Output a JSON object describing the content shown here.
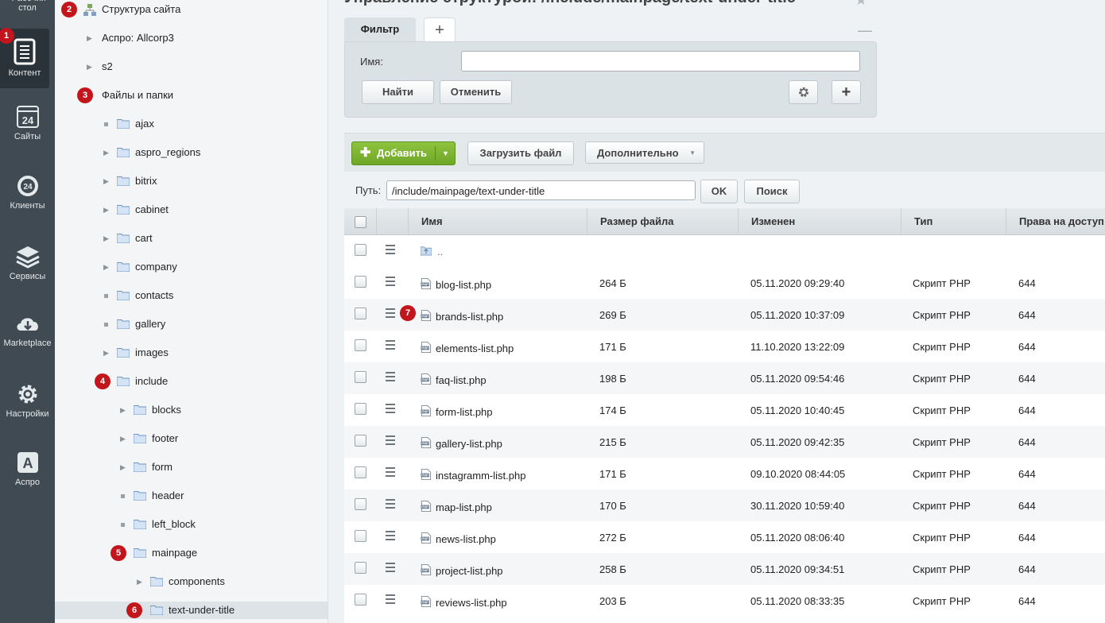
{
  "sidebar": {
    "items": [
      {
        "label": "Рабочий стол",
        "icon": "desktop-icon"
      },
      {
        "label": "Контент",
        "icon": "content-icon",
        "badge": "1"
      },
      {
        "label": "Сайты",
        "icon": "sites-icon"
      },
      {
        "label": "Клиенты",
        "icon": "clients-icon"
      },
      {
        "label": "Сервисы",
        "icon": "services-icon"
      },
      {
        "label": "Marketplace",
        "icon": "marketplace-icon"
      },
      {
        "label": "Настройки",
        "icon": "settings-icon"
      },
      {
        "label": "Аспро",
        "icon": "aspro-icon"
      }
    ],
    "icon_24": "24"
  },
  "tree": {
    "site_structure": {
      "label": "Структура сайта",
      "badge": "2"
    },
    "nodes": [
      {
        "label": "Аспро: Allcorp3"
      },
      {
        "label": "s2"
      },
      {
        "label": "Файлы и папки",
        "badge": "3"
      },
      {
        "label": "ajax"
      },
      {
        "label": "aspro_regions"
      },
      {
        "label": "bitrix"
      },
      {
        "label": "cabinet"
      },
      {
        "label": "cart"
      },
      {
        "label": "company"
      },
      {
        "label": "contacts"
      },
      {
        "label": "gallery"
      },
      {
        "label": "images"
      },
      {
        "label": "include",
        "badge": "4"
      },
      {
        "label": "blocks"
      },
      {
        "label": "footer"
      },
      {
        "label": "form"
      },
      {
        "label": "header"
      },
      {
        "label": "left_block"
      },
      {
        "label": "mainpage",
        "badge": "5"
      },
      {
        "label": "components"
      },
      {
        "label": "text-under-title",
        "badge": "6"
      }
    ]
  },
  "main": {
    "title": "Управление структурой: /include/mainpage/text-under-title",
    "filter": {
      "tab_label": "Фильтр",
      "add_tab": "+",
      "minimize": "—",
      "name_label": "Имя:",
      "name_value": "",
      "find_button": "Найти",
      "cancel_button": "Отменить",
      "settings_icon": "gear-icon",
      "add_button": "+"
    },
    "toolbar": {
      "add_label": "Добавить",
      "upload_label": "Загрузить файл",
      "more_label": "Дополнительно"
    },
    "path": {
      "label": "Путь:",
      "value": "/include/mainpage/text-under-title",
      "ok_button": "OK",
      "search_button": "Поиск"
    },
    "table": {
      "columns": [
        "Имя",
        "Размер файла",
        "Изменен",
        "Тип",
        "Права на доступ"
      ],
      "up_dir": "..",
      "row7_badge": "7",
      "rows": [
        {
          "name": "blog-list.php",
          "size": "264 Б",
          "modified": "05.11.2020 09:29:40",
          "type": "Скрипт PHP",
          "rights": "644"
        },
        {
          "name": "brands-list.php",
          "size": "269 Б",
          "modified": "05.11.2020 10:37:09",
          "type": "Скрипт PHP",
          "rights": "644"
        },
        {
          "name": "elements-list.php",
          "size": "171 Б",
          "modified": "11.10.2020 13:22:09",
          "type": "Скрипт PHP",
          "rights": "644"
        },
        {
          "name": "faq-list.php",
          "size": "198 Б",
          "modified": "05.11.2020 09:54:46",
          "type": "Скрипт PHP",
          "rights": "644"
        },
        {
          "name": "form-list.php",
          "size": "174 Б",
          "modified": "05.11.2020 10:40:45",
          "type": "Скрипт PHP",
          "rights": "644"
        },
        {
          "name": "gallery-list.php",
          "size": "215 Б",
          "modified": "05.11.2020 09:42:35",
          "type": "Скрипт PHP",
          "rights": "644"
        },
        {
          "name": "instagramm-list.php",
          "size": "171 Б",
          "modified": "09.10.2020 08:44:05",
          "type": "Скрипт PHP",
          "rights": "644"
        },
        {
          "name": "map-list.php",
          "size": "170 Б",
          "modified": "30.11.2020 10:59:40",
          "type": "Скрипт PHP",
          "rights": "644"
        },
        {
          "name": "news-list.php",
          "size": "272 Б",
          "modified": "05.11.2020 08:06:40",
          "type": "Скрипт PHP",
          "rights": "644"
        },
        {
          "name": "project-list.php",
          "size": "258 Б",
          "modified": "05.11.2020 09:34:51",
          "type": "Скрипт PHP",
          "rights": "644"
        },
        {
          "name": "reviews-list.php",
          "size": "203 Б",
          "modified": "05.11.2020 08:33:35",
          "type": "Скрипт PHP",
          "rights": "644"
        }
      ]
    }
  },
  "colors": {
    "accent_green": "#7ab530",
    "badge_red": "#c3161c",
    "sidebar_bg": "#3f4a52"
  }
}
